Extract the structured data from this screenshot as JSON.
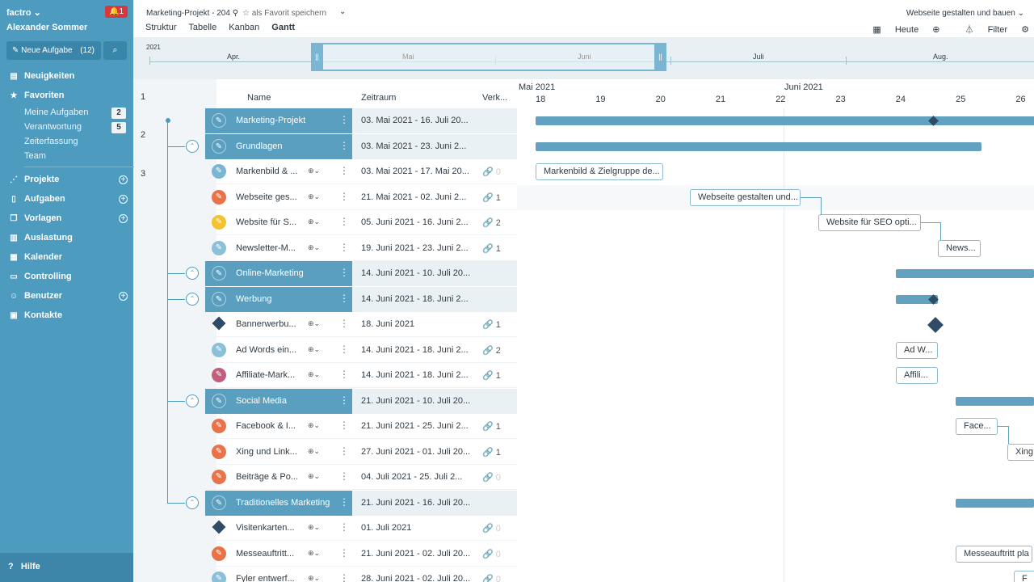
{
  "sidebar": {
    "brand": "factro",
    "notifications": "1",
    "user": "Alexander Sommer",
    "new_task": "Neue Aufgabe",
    "new_task_count": "(12)",
    "nav": {
      "news": "Neuigkeiten",
      "favorites": "Favoriten",
      "projects": "Projekte",
      "tasks": "Aufgaben",
      "templates": "Vorlagen",
      "load": "Auslastung",
      "calendar": "Kalender",
      "controlling": "Controlling",
      "users": "Benutzer",
      "contacts": "Kontakte"
    },
    "sub": {
      "my_tasks": "Meine Aufgaben",
      "my_tasks_count": "2",
      "responsible": "Verantwortung",
      "responsible_count": "5",
      "time": "Zeiterfassung",
      "team": "Team"
    },
    "help": "Hilfe"
  },
  "topbar": {
    "crumb": "Marketing-Projekt - 204",
    "fav": "als Favorit speichern",
    "views": [
      "Struktur",
      "Tabelle",
      "Kanban",
      "Gantt"
    ],
    "right_title": "Webseite gestalten und bauen",
    "today": "Heute",
    "filter": "Filter"
  },
  "strip": {
    "year": "2021",
    "months": [
      "Apr.",
      "Mai",
      "Juni",
      "Juli",
      "Aug."
    ]
  },
  "levels": [
    "1",
    "2",
    "3"
  ],
  "table": {
    "headers": {
      "name": "Name",
      "period": "Zeitraum",
      "links": "Verk..."
    },
    "rows": [
      {
        "name": "Marketing-Projekt",
        "period": "03. Mai 2021 - 16. Juli 20..."
      },
      {
        "name": "Grundlagen",
        "period": "03. Mai 2021 - 23. Juni 2..."
      },
      {
        "name": "Markenbild & ...",
        "period": "03. Mai 2021 - 17. Mai 20...",
        "links": "0"
      },
      {
        "name": "Webseite ges...",
        "period": "21. Mai 2021 - 02. Juni 2...",
        "links": "1"
      },
      {
        "name": "Website für S...",
        "period": "05. Juni 2021 - 16. Juni 2...",
        "links": "2"
      },
      {
        "name": "Newsletter-M...",
        "period": "19. Juni 2021 - 23. Juni 2...",
        "links": "1"
      },
      {
        "name": "Online-Marketing",
        "period": "14. Juni 2021 - 10. Juli 20..."
      },
      {
        "name": "Werbung",
        "period": "14. Juni 2021 - 18. Juni 2..."
      },
      {
        "name": "Bannerwerbu...",
        "period": "18. Juni 2021",
        "links": "1"
      },
      {
        "name": "Ad Words ein...",
        "period": "14. Juni 2021 - 18. Juni 2...",
        "links": "2"
      },
      {
        "name": "Affiliate-Mark...",
        "period": "14. Juni 2021 - 18. Juni 2...",
        "links": "1"
      },
      {
        "name": "Social Media",
        "period": "21. Juni 2021 - 10. Juli 20..."
      },
      {
        "name": "Facebook & I...",
        "period": "21. Juni 2021 - 25. Juni 2...",
        "links": "1"
      },
      {
        "name": "Xing und Link...",
        "period": "27. Juni 2021 - 01. Juli 20...",
        "links": "1"
      },
      {
        "name": "Beiträge & Po...",
        "period": "04. Juli 2021 - 25. Juli 2...",
        "links": "0"
      },
      {
        "name": "Traditionelles Marketing",
        "period": "21. Juni 2021 - 16. Juli 20..."
      },
      {
        "name": "Visitenkarten...",
        "period": "01. Juli 2021",
        "links": "0"
      },
      {
        "name": "Messeauftritt...",
        "period": "21. Juni 2021 - 02. Juli 20...",
        "links": "0"
      },
      {
        "name": "Fyler entwerf...",
        "period": "28. Juni 2021 - 02. Juli 20...",
        "links": "0"
      }
    ]
  },
  "gantt": {
    "months": [
      "Mai 2021",
      "Juni 2021"
    ],
    "days": [
      "18",
      "19",
      "20",
      "21",
      "22",
      "23",
      "24",
      "25",
      "26"
    ],
    "labels": {
      "r2": "Markenbild & Zielgruppe de...",
      "r3": "Webseite gestalten und...",
      "r4": "Website für SEO opti...",
      "r5": "News...",
      "r9": "Ad W...",
      "r10": "Affili...",
      "r12": "Face...",
      "r13": "Xing",
      "r17": "Messeauftritt pla",
      "r18": "F"
    }
  },
  "colors": {
    "sidebar": "#4d9bbf",
    "bar": "#62a1bf",
    "milestone": "#2f4b66"
  }
}
